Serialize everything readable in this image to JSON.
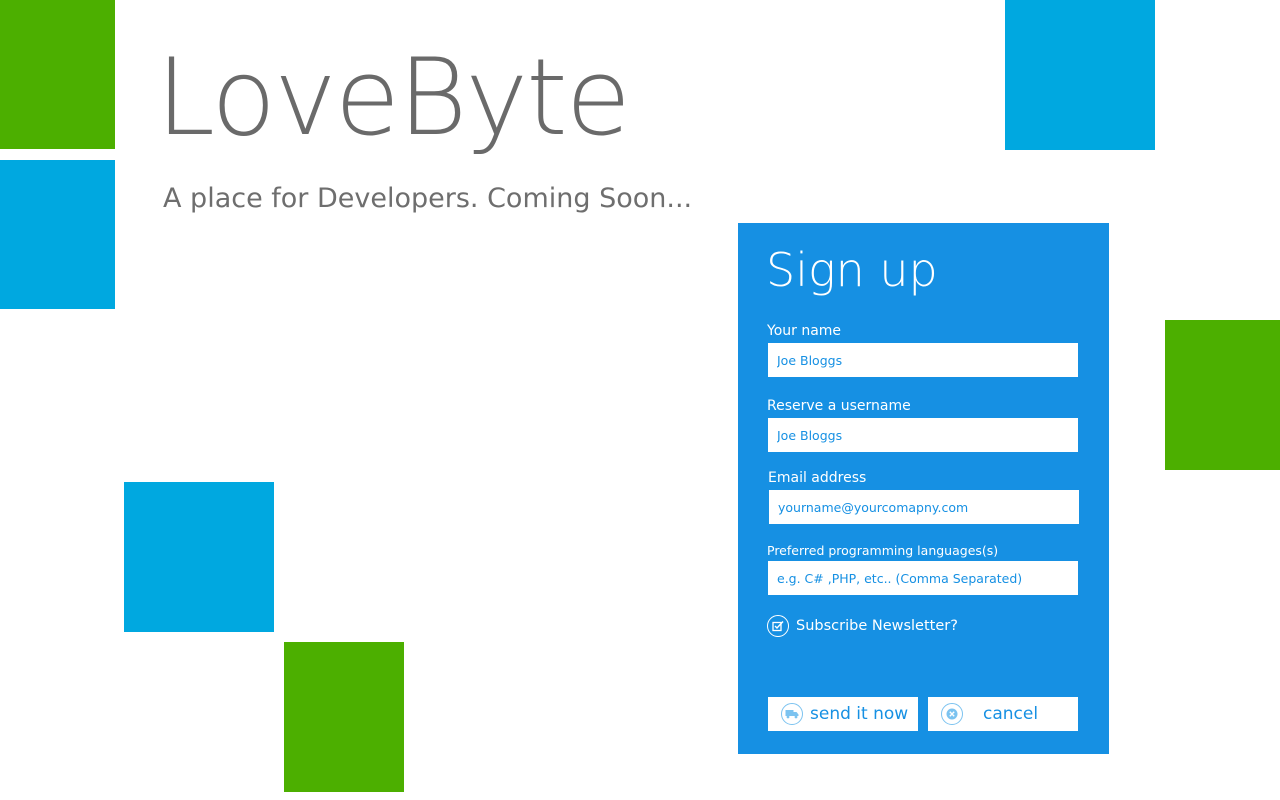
{
  "brand": {
    "title": "LoveByte",
    "tagline": "A place for Developers. Coming Soon..."
  },
  "colors": {
    "green_tile": "#4caf00",
    "blue_tile": "#00a8e0",
    "panel": "#1690e3",
    "heading_text": "#6a6a6a"
  },
  "signup": {
    "title": "Sign up",
    "fields": [
      {
        "label": "Your name",
        "value": "Joe Bloggs",
        "placeholder": ""
      },
      {
        "label": "Reserve a username",
        "value": "Joe Bloggs",
        "placeholder": ""
      },
      {
        "label": "Email address",
        "value": "",
        "placeholder": "yourname@yourcomapny.com"
      },
      {
        "label": "Preferred programming languages(s)",
        "value": "",
        "placeholder": "e.g. C# ,PHP, etc.. (Comma Separated)"
      }
    ],
    "newsletter": {
      "label": "Subscribe Newsletter?",
      "icon": "checkbox-circle-icon"
    },
    "buttons": {
      "send": {
        "label": "send it now",
        "icon": "send-truck-icon"
      },
      "cancel": {
        "label": "cancel",
        "icon": "close-circle-icon"
      }
    }
  }
}
